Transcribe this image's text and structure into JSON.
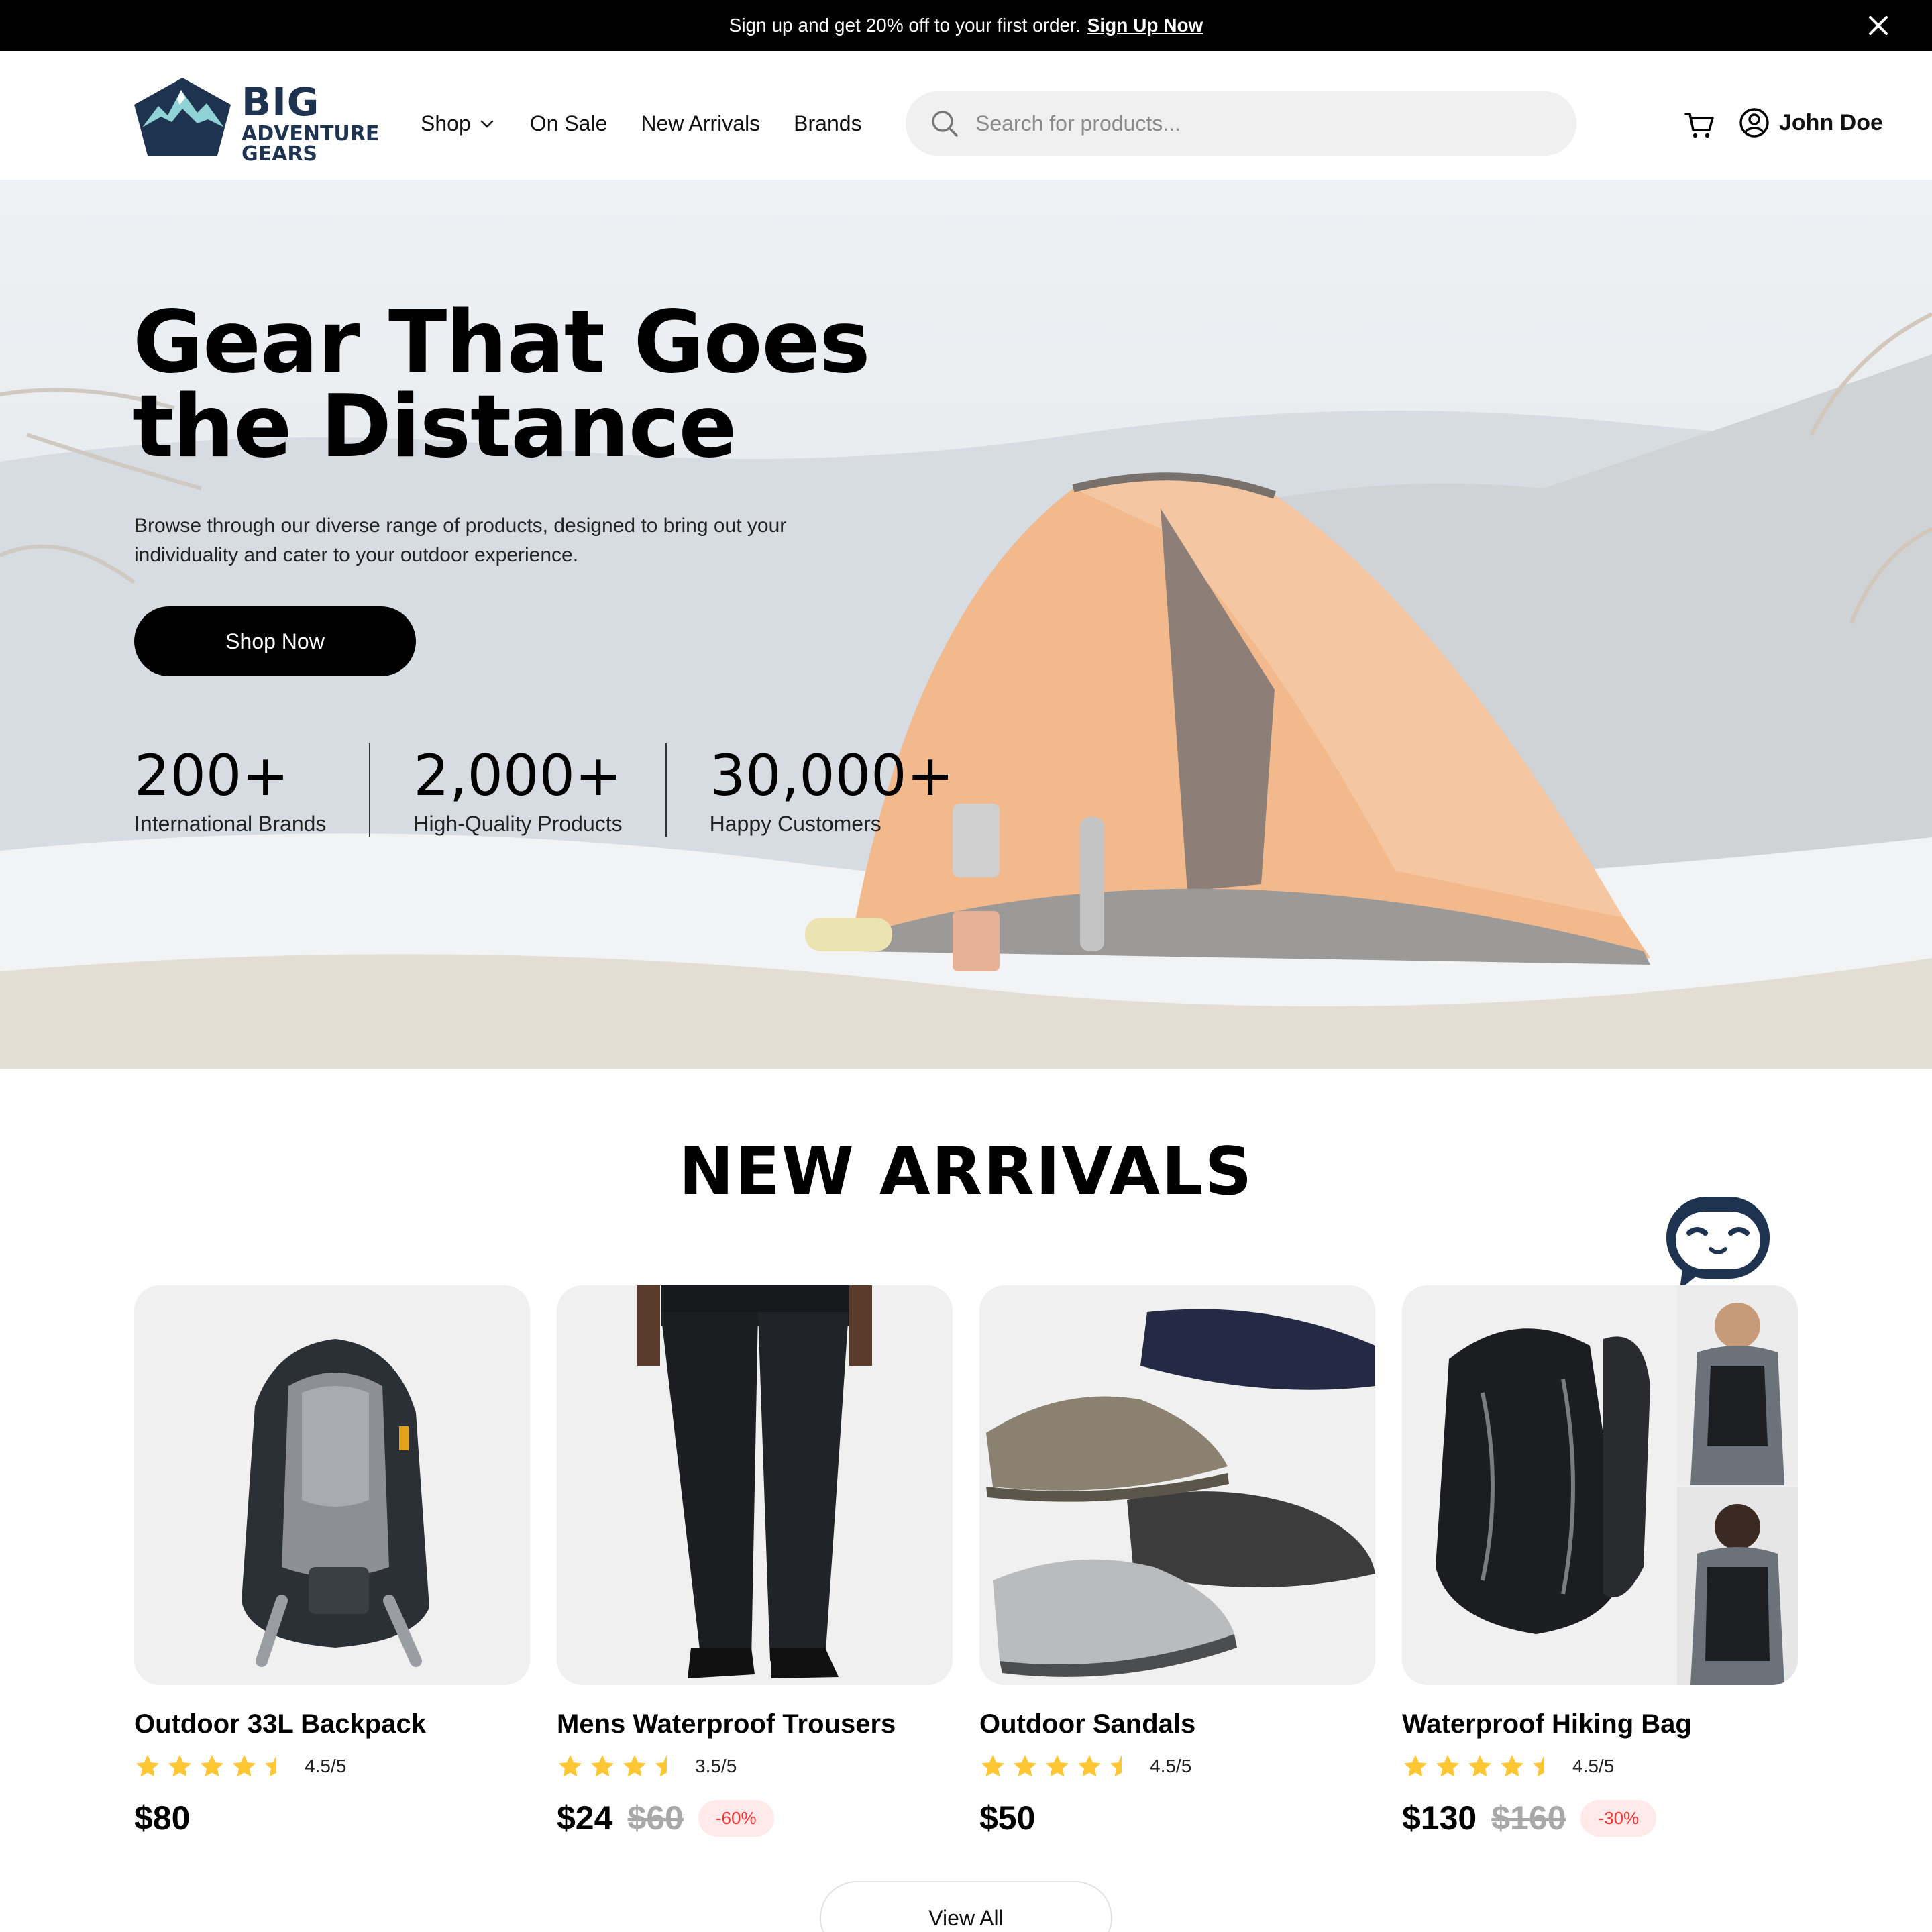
{
  "promo": {
    "text": "Sign up and get 20% off to your first order.",
    "link": "Sign Up Now"
  },
  "header": {
    "logo": {
      "line1": "BIG",
      "line2": "ADVENTURE",
      "line3": "GEARS"
    },
    "nav": [
      {
        "label": "Shop",
        "has_dropdown": true
      },
      {
        "label": "On Sale"
      },
      {
        "label": "New Arrivals"
      },
      {
        "label": "Brands"
      }
    ],
    "search_placeholder": "Search for products...",
    "user_name": "John Doe"
  },
  "hero": {
    "title": "Gear That Goes the Distance",
    "subtitle": "Browse through our diverse range of products, designed to bring out your individuality and cater to your outdoor experience.",
    "cta": "Shop Now",
    "stats": [
      {
        "value": "200+",
        "label": "International Brands"
      },
      {
        "value": "2,000+",
        "label": "High-Quality Products"
      },
      {
        "value": "30,000+",
        "label": "Happy Customers"
      }
    ]
  },
  "new_arrivals": {
    "title": "NEW ARRIVALS",
    "products": [
      {
        "name": "Outdoor 33L Backpack",
        "rating": "4.5/5",
        "stars": 4.5,
        "price": "$80",
        "old_price": "",
        "discount": ""
      },
      {
        "name": "Mens Waterproof Trousers",
        "rating": "3.5/5",
        "stars": 3.5,
        "price": "$24",
        "old_price": "$60",
        "discount": "-60%"
      },
      {
        "name": "Outdoor Sandals",
        "rating": "4.5/5",
        "stars": 4.5,
        "price": "$50",
        "old_price": "",
        "discount": ""
      },
      {
        "name": "Waterproof Hiking Bag",
        "rating": "4.5/5",
        "stars": 4.5,
        "price": "$130",
        "old_price": "$160",
        "discount": "-30%"
      }
    ],
    "view_all": "View All"
  },
  "colors": {
    "brand_navy": "#1e3350",
    "star": "#ffc633",
    "discount_text": "#ff3333",
    "discount_bg": "#ffe9e9"
  }
}
